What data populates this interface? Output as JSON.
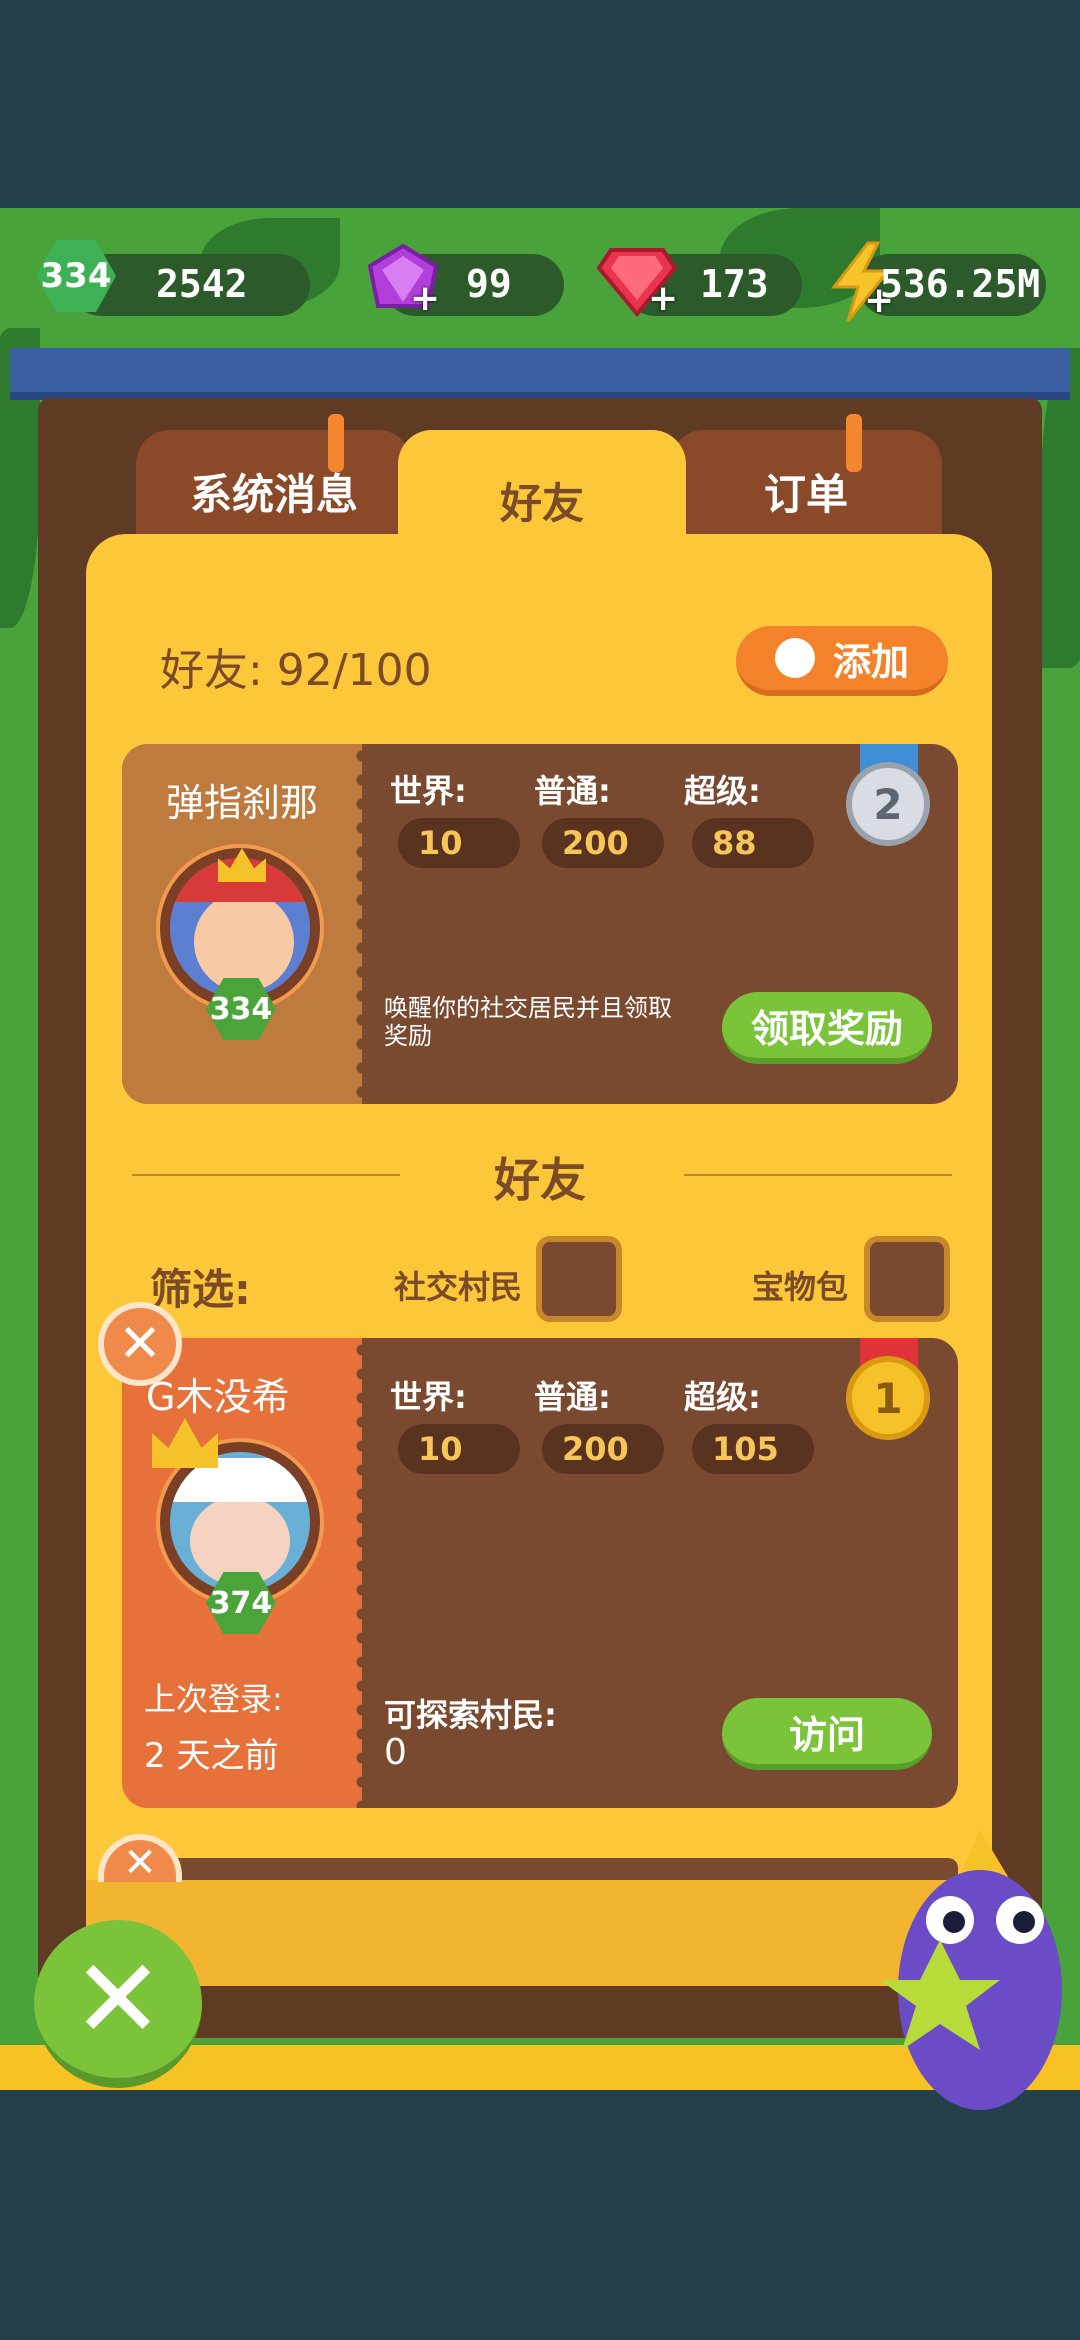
{
  "resources": {
    "level_badge": "334",
    "xp": "2542",
    "gems": "99",
    "rubies": "173",
    "energy": "536.25M"
  },
  "tabs": [
    {
      "label": "系统消息",
      "alert": true
    },
    {
      "label": "好友",
      "alert": false
    },
    {
      "label": "订单",
      "alert": true
    }
  ],
  "header": {
    "friends_count": "好友: 92/100",
    "add_label": "添加"
  },
  "my_card": {
    "name": "弹指刹那",
    "level": "334",
    "stat_labels": [
      "世界:",
      "普通:",
      "超级:"
    ],
    "stat_values": [
      "10",
      "200",
      "88"
    ],
    "rank": "2",
    "description": "唤醒你的社交居民并且领取奖励",
    "claim_label": "领取奖励"
  },
  "section_title": "好友",
  "filter": {
    "label": "筛选:",
    "option_social": "社交村民",
    "option_treasure": "宝物包"
  },
  "friends": [
    {
      "name": "G木没希",
      "level": "374",
      "stat_labels": [
        "世界:",
        "普通:",
        "超级:"
      ],
      "stat_values": [
        "10",
        "200",
        "105"
      ],
      "rank": "1",
      "last_login_label": "上次登录:",
      "last_login_value": "2 天之前",
      "explorable_label": "可探索村民:",
      "explorable_value": "0",
      "visit_label": "访问"
    }
  ],
  "colors": {
    "panel": "#fcc83a",
    "card": "#7a4a30",
    "button_green": "#7bc43a",
    "button_orange": "#f3822b",
    "frame_blue": "#3b5fa3"
  },
  "icons": [
    "level-hexagon-icon",
    "purple-gem-icon",
    "red-ruby-icon",
    "lightning-icon",
    "skull-add-icon",
    "silver-medal-icon",
    "gold-medal-icon",
    "remove-x-icon",
    "close-icon",
    "mascot-icon"
  ]
}
